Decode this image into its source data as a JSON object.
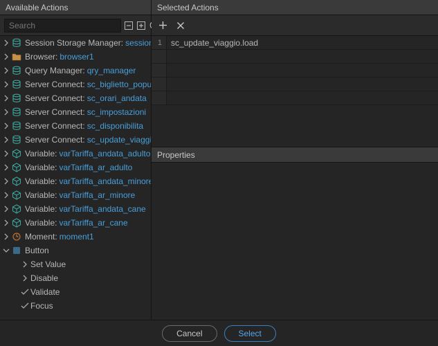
{
  "left": {
    "title": "Available Actions",
    "search_placeholder": "Search",
    "items": [
      {
        "label": "Session Storage Manager:",
        "value": "session_manager"
      },
      {
        "label": "Browser:",
        "value": "browser1"
      },
      {
        "label": "Query Manager:",
        "value": "qry_manager"
      },
      {
        "label": "Server Connect:",
        "value": "sc_biglietto_populate"
      },
      {
        "label": "Server Connect:",
        "value": "sc_orari_andata"
      },
      {
        "label": "Server Connect:",
        "value": "sc_impostazioni"
      },
      {
        "label": "Server Connect:",
        "value": "sc_disponibilita"
      },
      {
        "label": "Server Connect:",
        "value": "sc_update_viaggio"
      },
      {
        "label": "Variable:",
        "value": "varTariffa_andata_adulto"
      },
      {
        "label": "Variable:",
        "value": "varTariffa_ar_adulto"
      },
      {
        "label": "Variable:",
        "value": "varTariffa_andata_minore"
      },
      {
        "label": "Variable:",
        "value": "varTariffa_ar_minore"
      },
      {
        "label": "Variable:",
        "value": "varTariffa_andata_cane"
      },
      {
        "label": "Variable:",
        "value": "varTariffa_ar_cane"
      },
      {
        "label": "Moment:",
        "value": "moment1"
      },
      {
        "label": "Button",
        "value": ""
      }
    ],
    "button_children": [
      "Set Value",
      "Disable",
      "Validate",
      "Focus"
    ]
  },
  "right": {
    "title": "Selected Actions",
    "rows": [
      {
        "n": "1",
        "v": "sc_update_viaggio.load"
      }
    ],
    "props_title": "Properties"
  },
  "footer": {
    "cancel": "Cancel",
    "select": "Select"
  }
}
